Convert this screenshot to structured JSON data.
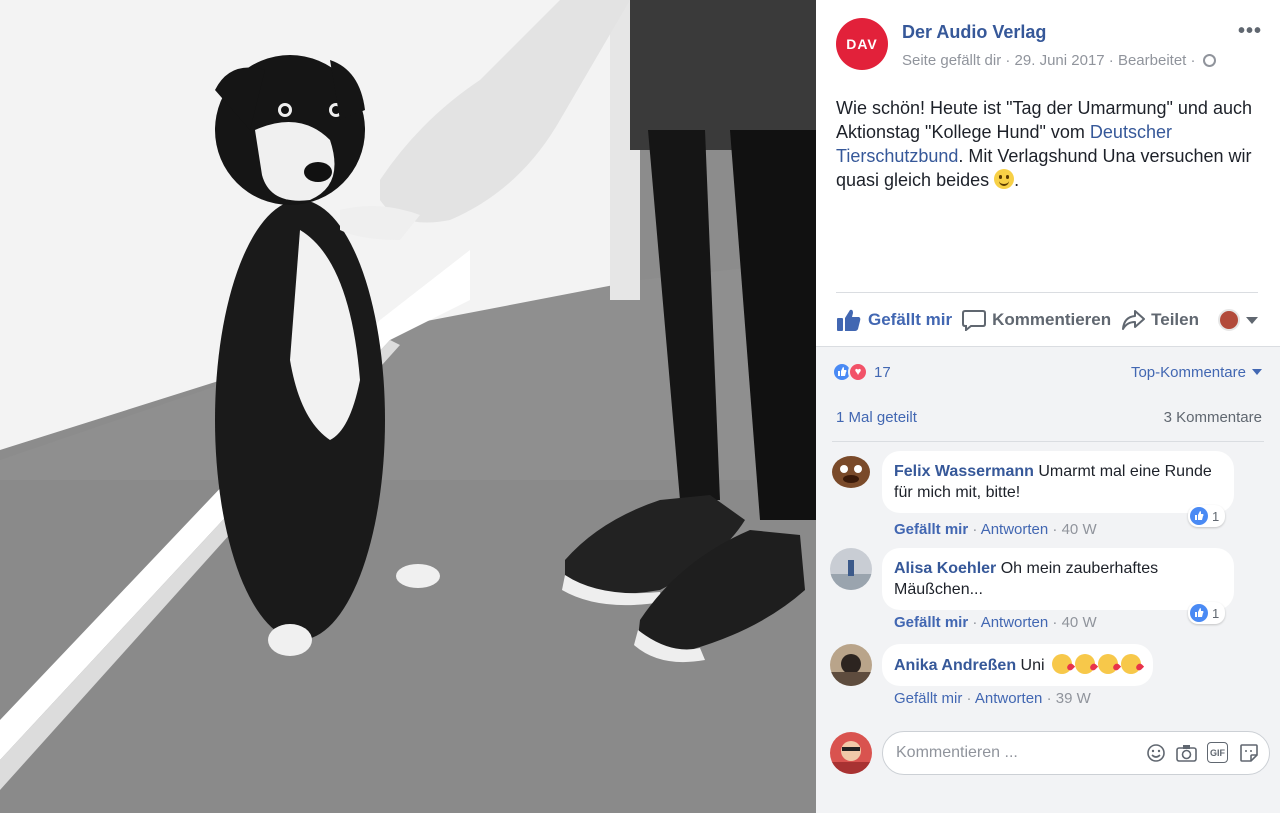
{
  "post": {
    "page_name": "Der Audio Verlag",
    "logo_text": "DAV",
    "meta": "Seite gefällt dir · 29. Juni 2017 · Bearbeitet ·",
    "text_part1": "Wie schön! Heute ist \"Tag der Umarmung\" und auch Aktionstag \"Kollege Hund\" vom ",
    "text_link": "Deutscher Tierschutzbund",
    "text_part2": ". Mit Verlagshund Una versuchen wir quasi gleich beides ",
    "text_end": "."
  },
  "actions": {
    "like": "Gefällt mir",
    "comment": "Kommentieren",
    "share": "Teilen"
  },
  "reactions": {
    "count": "17",
    "sort_label": "Top-Kommentare",
    "shares": "1 Mal geteilt",
    "comments_count": "3 Kommentare"
  },
  "comments": [
    {
      "author": "Felix Wassermann",
      "text": "Umarmt mal eine Runde für mich mit, bitte!",
      "like": "Gefällt mir",
      "reply": "Antworten",
      "time": "40 W",
      "reaction_count": "1"
    },
    {
      "author": "Alisa Koehler",
      "text": "Oh mein zauberhaftes Mäußchen...",
      "like": "Gefällt mir",
      "reply": "Antworten",
      "time": "40 W",
      "reaction_count": "1"
    },
    {
      "author": "Anika Andreßen",
      "text": "Uni",
      "like": "Gefällt mir",
      "reply": "Antworten",
      "time": "39 W"
    }
  ],
  "composer": {
    "placeholder": "Kommentieren ...",
    "gif_label": "GIF"
  },
  "colors": {
    "link": "#365899",
    "brand": "#e2213a",
    "like_blue": "#4267b2"
  }
}
